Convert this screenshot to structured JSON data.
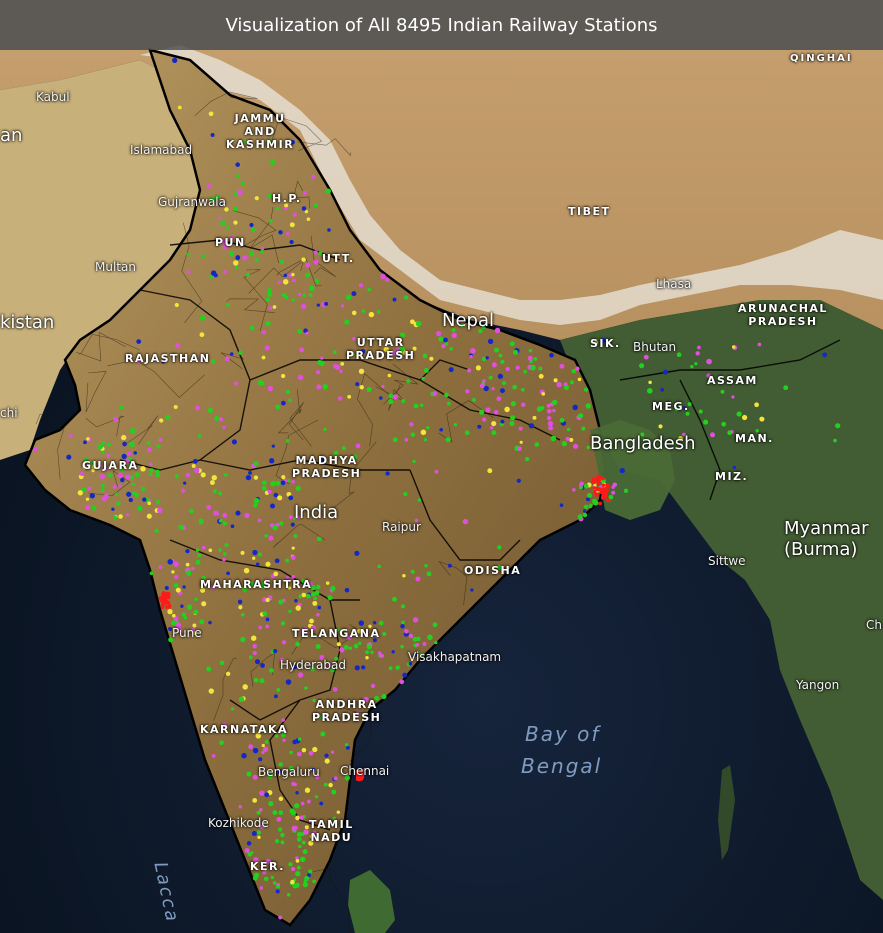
{
  "title": "Visualization of All 8495 Indian Railway Stations",
  "colors": {
    "ocean": "#0f1c30",
    "land_south": "#9a7b4a",
    "land_tibet": "#c9a774",
    "himalaya": "#e9e6df",
    "green_forest": "#3d5a2e",
    "station_green": "#22d11f",
    "station_magenta": "#e24fe0",
    "station_blue": "#1428c8",
    "station_yellow": "#f1e43a",
    "station_red": "#ff1a1a",
    "border": "#000000"
  },
  "labels": {
    "qinghai": "QINGHAI",
    "kabul": "Kabul",
    "an": "an",
    "islamabad": "Islamabad",
    "jk1": "JAMMU",
    "jk2": "AND",
    "jk3": "KASHMIR",
    "gujranwala": "Gujranwala",
    "hp": "H.P.",
    "tibet": "TIBET",
    "punjab": "PUN",
    "multan": "Multan",
    "utt": "UTT.",
    "lhasa": "Lhasa",
    "arunachal1": "ARUNACHAL",
    "arunachal2": "PRADESH",
    "kistan": "kistan",
    "nepal": "Nepal",
    "sik": "SIK.",
    "bhutan": "Bhutan",
    "rajasthan": "RAJASTHAN",
    "up1": "UTTAR",
    "up2": "PRADESH",
    "assam": "ASSAM",
    "meg": "MEG.",
    "chi": "chi",
    "bangladesh": "Bangladesh",
    "man": "MAN.",
    "gujarat": "GUJARA",
    "mp1": "MADHYA",
    "mp2": "PRADESH",
    "miz": "MIZ.",
    "india": "India",
    "raipur": "Raipur",
    "myanmar1": "Myanmar",
    "myanmar2": "(Burma)",
    "sittwe": "Sittwe",
    "maharashtra": "MAHARASHTRA",
    "odisha": "ODISHA",
    "pune": "Pune",
    "telangana": "TELANGANA",
    "hyderabad": "Hyderabad",
    "visakhapatnam": "Visakhapatnam",
    "ch": "Ch",
    "yangon": "Yangon",
    "ap1": "ANDHRA",
    "ap2": "PRADESH",
    "karnataka": "KARNATAKA",
    "bay1": "Bay of",
    "bay2": "Bengal",
    "bengaluru": "Bengaluru",
    "chennai": "Chennai",
    "kozhikode": "Kozhikode",
    "tn1": "TAMIL",
    "tn2": "NADU",
    "ker": "KER.",
    "lacca": "Lacca"
  }
}
